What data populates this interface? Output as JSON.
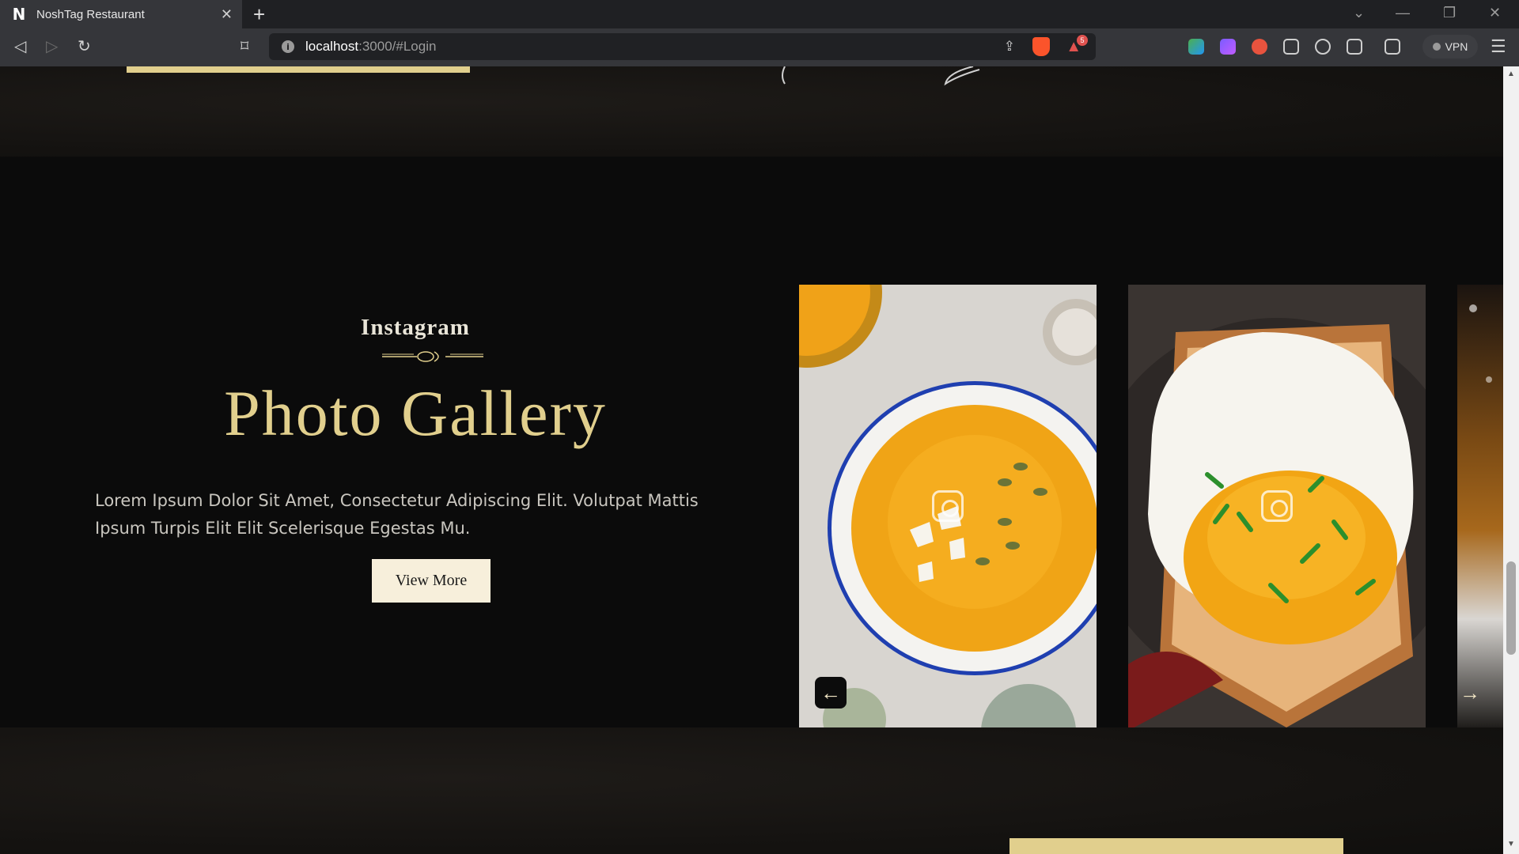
{
  "browser": {
    "tab_title": "NoshTag Restaurant",
    "tab_logo": "N",
    "url_host": "localhost",
    "url_path": ":3000/#Login",
    "vpn_label": "VPN",
    "rewards_count": "5"
  },
  "gallery": {
    "subtitle": "Instagram",
    "title": "Photo Gallery",
    "description": "Lorem Ipsum Dolor Sit Amet, Consectetur Adipiscing Elit. Volutpat Mattis Ipsum Turpis Elit Elit Scelerisque Egestas Mu.",
    "button_label": "View More",
    "slides": [
      {
        "icon": "instagram-icon",
        "image": "pumpkin-soup-photo"
      },
      {
        "icon": "instagram-icon",
        "image": "fried-egg-toast-photo"
      },
      {
        "icon": "instagram-icon",
        "image": "drink-photo"
      }
    ],
    "prev_icon": "arrow-left-icon",
    "next_icon": "arrow-right-icon"
  },
  "colors": {
    "accent_gold": "#e1cf8d",
    "background": "#0b0b0b",
    "button_bg": "#f7efdb"
  }
}
